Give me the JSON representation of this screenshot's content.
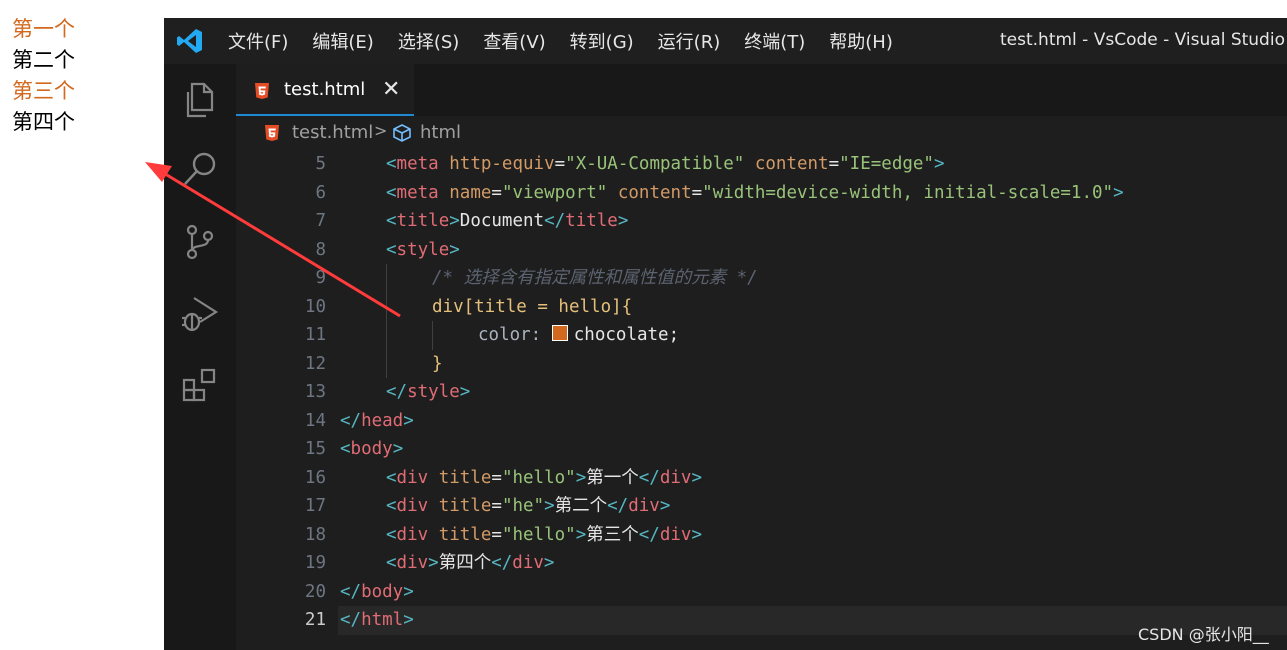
{
  "preview": {
    "lines": [
      "第一个",
      "第二个",
      "第三个",
      "第四个"
    ],
    "colors": [
      "#d2691e",
      "#000000",
      "#d2691e",
      "#000000"
    ]
  },
  "titlebar": {
    "menu": [
      "文件(F)",
      "编辑(E)",
      "选择(S)",
      "查看(V)",
      "转到(G)",
      "运行(R)",
      "终端(T)",
      "帮助(H)"
    ],
    "window_title": "test.html - VsCode - Visual Studio Co"
  },
  "activity_bar": {
    "icons": [
      "explorer-icon",
      "search-icon",
      "source-control-icon",
      "run-debug-icon",
      "extensions-icon"
    ]
  },
  "tab": {
    "label": "test.html",
    "close": "✕"
  },
  "breadcrumb": {
    "file": "test.html",
    "separator": ">",
    "symbol": "html"
  },
  "line_numbers": [
    "5",
    "6",
    "7",
    "8",
    "9",
    "10",
    "11",
    "12",
    "13",
    "14",
    "15",
    "16",
    "17",
    "18",
    "19",
    "20",
    "21"
  ],
  "current_line": "21",
  "code": {
    "l5_tag": "meta",
    "l5_a1": "http-equiv",
    "l5_v1": "\"X-UA-Compatible\"",
    "l5_a2": "content",
    "l5_v2": "\"IE=edge\"",
    "l6_tag": "meta",
    "l6_a1": "name",
    "l6_v1": "\"viewport\"",
    "l6_a2": "content",
    "l6_v2": "\"width=device-width, initial-scale=1.0\"",
    "l7_tag": "title",
    "l7_text": "Document",
    "l8_tag": "style",
    "l9_comment": "/* 选择含有指定属性和属性值的元素 */",
    "l10_selector": "div[title = hello]{",
    "l11_prop": "color:",
    "l11_value": "chocolate",
    "l11_semicolon": ";",
    "l12_brace": "}",
    "l13_tag": "style",
    "l14_tag": "head",
    "l15_tag": "body",
    "l16_tag": "div",
    "l16_attr": "title",
    "l16_val": "\"hello\"",
    "l16_text": "第一个",
    "l17_tag": "div",
    "l17_attr": "title",
    "l17_val": "\"he\"",
    "l17_text": "第二个",
    "l18_tag": "div",
    "l18_attr": "title",
    "l18_val": "\"hello\"",
    "l18_text": "第三个",
    "l19_tag": "div",
    "l19_text": "第四个",
    "l20_tag": "body",
    "l21_tag": "html"
  },
  "watermark": "CSDN @张小阳__",
  "colors": {
    "chocolate": "#d2691e",
    "tab_accent": "#1f8ad2",
    "vscode_blue": "#23a9f2"
  }
}
